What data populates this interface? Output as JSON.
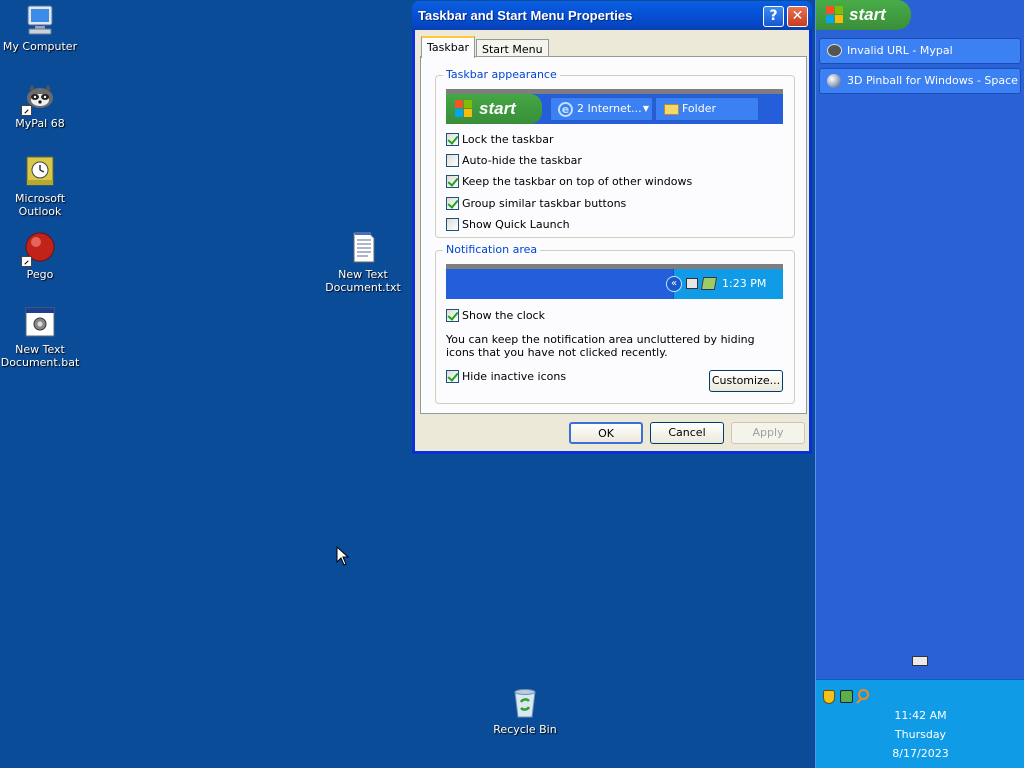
{
  "desktop": {
    "icons": [
      {
        "label": "My Computer",
        "icon": "computer-icon"
      },
      {
        "label": "MyPal 68",
        "icon": "raccoon-icon"
      },
      {
        "label": "Microsoft Outlook",
        "icon": "outlook-icon"
      },
      {
        "label": "Pego",
        "icon": "pego-icon"
      },
      {
        "label": "New Text Document.bat",
        "icon": "batch-file-icon"
      },
      {
        "label": "New Text Document.txt",
        "icon": "text-file-icon"
      },
      {
        "label": "Recycle Bin",
        "icon": "recycle-bin-icon"
      }
    ]
  },
  "dialog": {
    "title": "Taskbar and Start Menu Properties",
    "help_glyph": "?",
    "close_glyph": "✕",
    "tabs": [
      "Taskbar",
      "Start Menu"
    ],
    "appearance": {
      "legend": "Taskbar appearance",
      "preview": {
        "start": "start",
        "ie_button": "2 Internet...",
        "folder_button": "Folder"
      },
      "options": [
        {
          "label": "Lock the taskbar",
          "checked": true
        },
        {
          "label": "Auto-hide the taskbar",
          "checked": false
        },
        {
          "label": "Keep the taskbar on top of other windows",
          "checked": true
        },
        {
          "label": "Group similar taskbar buttons",
          "checked": true
        },
        {
          "label": "Show Quick Launch",
          "checked": false
        }
      ]
    },
    "notification": {
      "legend": "Notification area",
      "preview_time": "1:23 PM",
      "show_clock": {
        "label": "Show the clock",
        "checked": true
      },
      "description": "You can keep the notification area uncluttered by hiding icons that you have not clicked recently.",
      "hide_inactive": {
        "label": "Hide inactive icons",
        "checked": true
      },
      "customize": "Customize..."
    },
    "buttons": {
      "ok": "OK",
      "cancel": "Cancel",
      "apply": "Apply"
    }
  },
  "taskbar": {
    "start": "start",
    "tasks": [
      {
        "label": "Invalid URL - Mypal",
        "icon": "mypal-icon"
      },
      {
        "label": "3D Pinball for Windows - Space ...",
        "icon": "pinball-icon"
      }
    ],
    "clock": {
      "time": "11:42 AM",
      "day": "Thursday",
      "date": "8/17/2023"
    }
  },
  "colors": {
    "desktop": "#0b4c99",
    "taskbar": "#2a62d6",
    "tray": "#0f9be6",
    "title": "#0653d8",
    "accent_legend": "#0046d5"
  }
}
